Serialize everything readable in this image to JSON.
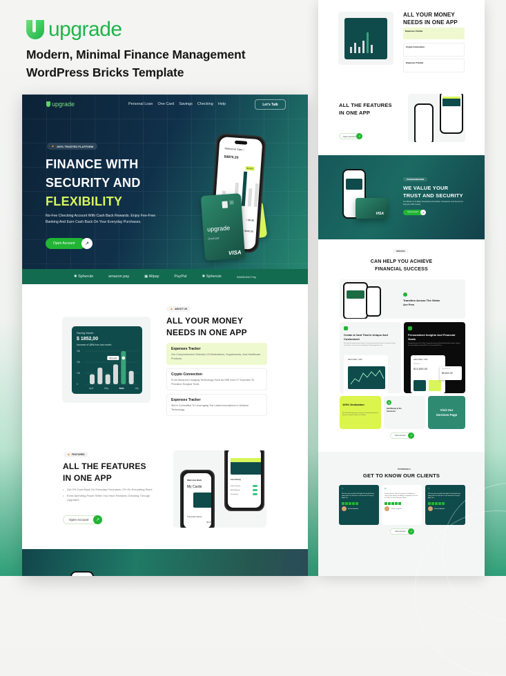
{
  "brand": {
    "name": "upgrade",
    "tagline_line1": "Modern, Minimal Finance Management",
    "tagline_line2": "WordPress  Bricks Template"
  },
  "hero": {
    "nav_logo": "upgrade",
    "nav_links": [
      "Personal Loan",
      "One Card",
      "Savings",
      "Checking",
      "Help"
    ],
    "cta_nav": "Let's Talk",
    "badge": "100% TRUSTED PLATFORM",
    "headline_line1": "FINANCE WITH",
    "headline_line2": "SECURITY AND",
    "headline_accent": "FLEXIBILITY",
    "description": "No-Fee Checking Account With Cash Back Rewards. Enjoy Fee-Free Banking And Earn Cash Back On Your Everyday Purchases.",
    "cta_button": "Open Account",
    "phone_welcome": "Welcome Sam !",
    "phone_balance": "$9870.20",
    "phone_chart_label": "$5,600",
    "phone_rows": [
      "+ $6.98",
      "+ $440.00"
    ],
    "card_brand": "upgrade",
    "card_name": "OneCard",
    "card_network": "VISA",
    "side_card_text": "pp"
  },
  "partners": [
    "Spherule",
    "amazon pay",
    "Alipay",
    "PayPal",
    "Spherule",
    "SAMSUNG Pay"
  ],
  "about": {
    "tag": "ABOUT US",
    "title_line1": "ALL YOUR MONEY",
    "title_line2": "NEEDS IN ONE APP",
    "features": [
      {
        "title": "Expenses Tracker",
        "desc": "Our Comprehensive Selection Of Medications, Supplements, And Healthcare Products."
      },
      {
        "title": "Crypto Connection",
        "desc": "From Advanced Imaging Technology Such As MRI And CT Scanners To Precision Surgical Tools."
      },
      {
        "title": "Expenses Tracker",
        "desc": "We're Committed To Leveraging The Latest Innovations In Medical Technology."
      }
    ],
    "saving_card": {
      "label": "Saving Month",
      "amount": "$ 1852,00",
      "note_prefix": "Increase of ",
      "note_pct": "12%",
      "note_suffix": " from last month",
      "tooltip": "$32,000"
    }
  },
  "chart_data": {
    "type": "bar",
    "title": "Saving Month",
    "categories": [
      "April",
      "",
      "May",
      "",
      "June",
      ""
    ],
    "x_tick_labels": [
      "April",
      "May",
      "June",
      "July"
    ],
    "values": [
      9,
      15,
      9,
      18,
      30,
      12
    ],
    "highlight_index": 4,
    "y_tick_labels": [
      "0",
      "10k",
      "20k",
      "30k"
    ],
    "ylim": [
      0,
      30
    ],
    "ylabel": "",
    "xlabel": "",
    "grid": true,
    "tooltip": "$32,000"
  },
  "features": {
    "tag": "FEATURED",
    "title_line1": "ALL THE FEATURES",
    "title_line2": "IN ONE APP",
    "bullets": [
      "Get 3% Cash Back On Everyday Purchases, 2% On Everything Else4",
      "Extra Spending Power When You Have Rewards Checking Through Upgrade5"
    ],
    "cta": "Open Account",
    "phone_welcome": "Welcome Back",
    "phone_title": "My Cards",
    "phone_history": "Transaction History",
    "phone_amount": "- $5.00",
    "card_label": "Card Setting",
    "toggles": [
      "Online Payment",
      "ATM Withdraws",
      "International"
    ]
  },
  "right": {
    "trust": {
      "tag": "TRANSFORMATIONS",
      "title_line1": "WE VALUE YOUR",
      "title_line2": "TRUST AND SECURITY",
      "desc": "Our Mission Is To Make Transactions Accessible, Transparent, And Secure For Everyone With Cutting",
      "cta": "Open Account"
    },
    "help": {
      "tag": "SERVICES",
      "title_line1": "CAN HELP YOU ACHIEVE",
      "title_line2": "FINANCIAL SUCCESS",
      "transfers": "Transfers Across The Globe Are Free",
      "create_card_title": "Create A Card That Is Unique And Customized",
      "create_card_desc": "We Offer A Comprehensive Range Of Innovative Financial Services Tailored To Meet Your Needs. Our Services Include High Yield Savings Accounts.",
      "welcome": "WELCOME, TOM !",
      "insights_title": "Personalized Insights And Financial Goals",
      "insights_desc": "Savings Accounts That Offer Competitive Interest Rates And Flexible Deposit Options. Investment Advice Ready With Our Personalized Plans.",
      "balance_label": "BALANCE",
      "balance": "$13,553.00",
      "total_balance_label": "Total Balance",
      "total_balance": "$9,641.00",
      "dedication_title": "100% Dedication",
      "dedication_desc": "We Offer A Comprehensive Range Of Innovative Financial Services Tailored To Meet Your Needs",
      "hold_money": "Hold Money In 25+ Currencies",
      "visit": "Visit Our Services Page",
      "cta": "Open Account"
    },
    "clients": {
      "tag": "TESTIMONIALS",
      "title": "GET TO KNOW OUR CLIENTS",
      "cards": [
        {
          "text": "We Have Successfully Sold Digital Product And Have Happy With The Results & Look Forward To Using It Again Too.",
          "name": "Michelle Adaobia",
          "role": "Marketing Manager"
        },
        {
          "text": "Design Ideation Offers Thorough & Cost-Effective Testing Tools Having The Ability To Rapidly Prove That It's Worth On Each Designed Vision.",
          "name": "Thomas Ragmael",
          "role": "Product Lead"
        },
        {
          "text": "We Have Successfully Sold Digital Product And Have Happy With The Results & Look Forward To Using It Again Too.",
          "name": "Michelle Adaobia",
          "role": "Marketing Manager"
        }
      ],
      "cta": "Open Account"
    },
    "about_mini_title_line1": "ALL YOUR MONEY",
    "about_mini_title_line2": "NEEDS IN ONE APP",
    "features_mini_title_line1": "ALL THE FEATURES",
    "features_mini_title_line2": "IN ONE APP",
    "features_mini_cta": "Open Account"
  },
  "colors": {
    "brand_green": "#1fb54a",
    "accent_lime": "#d8f55c",
    "dark_teal": "#0f4b4a",
    "partner_bar": "#136b4f"
  }
}
